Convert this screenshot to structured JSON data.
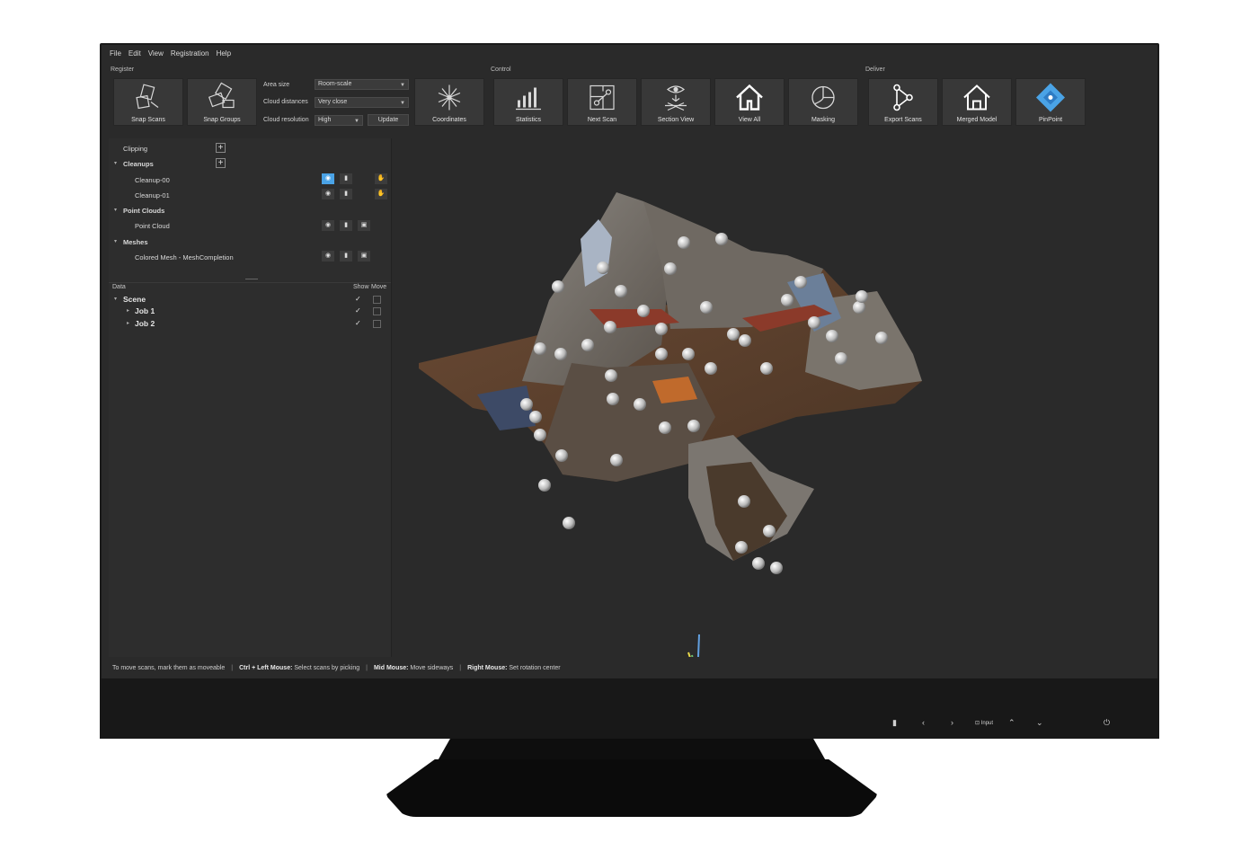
{
  "menu": [
    "File",
    "Edit",
    "View",
    "Registration",
    "Help"
  ],
  "groups": {
    "register": "Register",
    "control": "Control",
    "deliver": "Deliver"
  },
  "tools": {
    "snap_scans": "Snap Scans",
    "snap_groups": "Snap Groups",
    "coordinates": "Coordinates",
    "statistics": "Statistics",
    "next_scan": "Next Scan",
    "section_view": "Section View",
    "view_all": "View All",
    "masking": "Masking",
    "export_scans": "Export Scans",
    "merged_model": "Merged Model",
    "pinpoint": "PinPoint"
  },
  "form": {
    "area_size_label": "Area size",
    "area_size_value": "Room-scale",
    "cloud_distances_label": "Cloud distances",
    "cloud_distances_value": "Very close",
    "cloud_resolution_label": "Cloud resolution",
    "cloud_resolution_value": "High",
    "update_label": "Update"
  },
  "panel": {
    "clipping": "Clipping",
    "cleanups": "Cleanups",
    "cleanup_00": "Cleanup-00",
    "cleanup_01": "Cleanup-01",
    "point_clouds": "Point Clouds",
    "point_cloud": "Point Cloud",
    "meshes": "Meshes",
    "colored_mesh": "Colored Mesh - MeshCompletion"
  },
  "data": {
    "header": "Data",
    "show": "Show",
    "move": "Move",
    "scene": "Scene",
    "job1": "Job 1",
    "job2": "Job 2"
  },
  "status": {
    "hint": "To move scans, mark them as moveable",
    "ctrl_key": "Ctrl + Left Mouse:",
    "ctrl_text": "Select scans by picking",
    "mid_key": "Mid Mouse:",
    "mid_text": "Move sideways",
    "right_key": "Right Mouse:",
    "right_text": "Set rotation center"
  },
  "monitor_controls": {
    "input": "Input"
  },
  "colors": {
    "accent": "#4aa3e6",
    "axis_x": "#e0442c",
    "axis_y": "#62a0e0",
    "axis_z": "#e8d84a",
    "axis_w": "#6cc070"
  }
}
